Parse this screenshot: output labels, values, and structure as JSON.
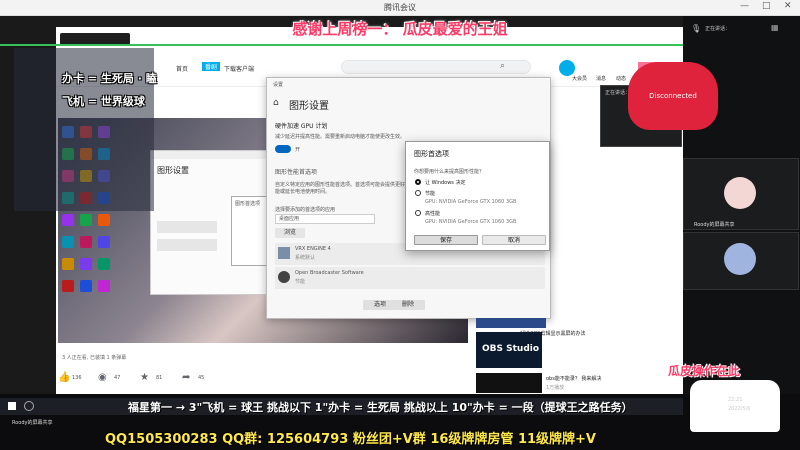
{
  "window": {
    "title": "腾讯会议",
    "controls": [
      "—",
      "□",
      "✕"
    ]
  },
  "overlay": {
    "banner": "感谢上周榜一：   瓜皮最爱的王姐",
    "line1": "办卡 = 生死局 · 瞌",
    "line2": "飞机 = 世界级球",
    "ticker": "福星第一 → 3\"飞机 = 球王  挑战以下 1\"办卡 = 生死局  挑战以上 10\"办卡 = 一段（提球王之路任务）",
    "contact": "QQ1505300283   QQ群: 125604793   粉丝团+V群  16级牌牌房管  11级牌牌+V"
  },
  "browser": {
    "tabs": [
      "首页",
      "番剧",
      "下载客户端"
    ],
    "search_placeholder": "",
    "nav_icons": [
      "大会员",
      "消息",
      "动态",
      "收藏",
      "历史",
      "创作中心"
    ],
    "upload": "投稿",
    "bottom_meta": "3 人正在看, 已装填 1 条弹幕",
    "stats": {
      "likes": "136",
      "coins": "47",
      "favs": "81",
      "shares": "45"
    }
  },
  "dialog_main": {
    "title": "设置",
    "heading": "图形设置",
    "section1": "硬件加速 GPU 计划",
    "section1_desc": "减少延迟并提高性能。需要重新启动电脑才能使更改生效。",
    "toggle": "开",
    "section2": "图形性能首选项",
    "section2_desc": "自定义特定应用的图形性能首选项。首选项可能会提供更好的应用性能或延长电池使用时间。",
    "browse_label": "选择要添加的首选项的应用",
    "dropdown": "桌面应用",
    "browse_btn": "浏览",
    "apps": [
      {
        "name": "VRX ENGINE 4",
        "sub": "系统默认"
      },
      {
        "name": "Open Broadcaster Software",
        "sub": "节能"
      }
    ],
    "option_btn": "选项",
    "delete_btn": "删除"
  },
  "popup": {
    "title": "图形首选项",
    "question": "你想要用什么来提高图形性能？",
    "options": [
      {
        "label": "让 Windows 决定",
        "sub": "",
        "checked": true
      },
      {
        "label": "节能",
        "sub": "GPU: NVIDIA GeForce GTX 1060 3GB",
        "checked": false
      },
      {
        "label": "高性能",
        "sub": "GPU: NVIDIA GeForce GTX 1060 3GB",
        "checked": false
      }
    ],
    "save": "保存",
    "cancel": "取消"
  },
  "meeting": {
    "speaker": "正在讲话：",
    "disconnected": "Disconnected",
    "participants": [
      "Roody的屏幕共享",
      ""
    ],
    "bottom_label": "瓜皮操作在此"
  },
  "sidebar_videos": [
    {
      "title": "解决OBS剪辑显示黑屏的办法",
      "meta": "2万播放"
    },
    {
      "title": "OBS Studio",
      "meta": ""
    },
    {
      "title": "obs能不能录？ 我来解决",
      "meta": "1万播放"
    }
  ],
  "taskbar": {
    "time": "22:21",
    "date": "2022/5/6",
    "share": "Roody的屏幕共享"
  },
  "colors": {
    "accent": "#ff3a66",
    "green": "#37c15a",
    "red": "#e0233d",
    "blue": "#00aeec"
  }
}
